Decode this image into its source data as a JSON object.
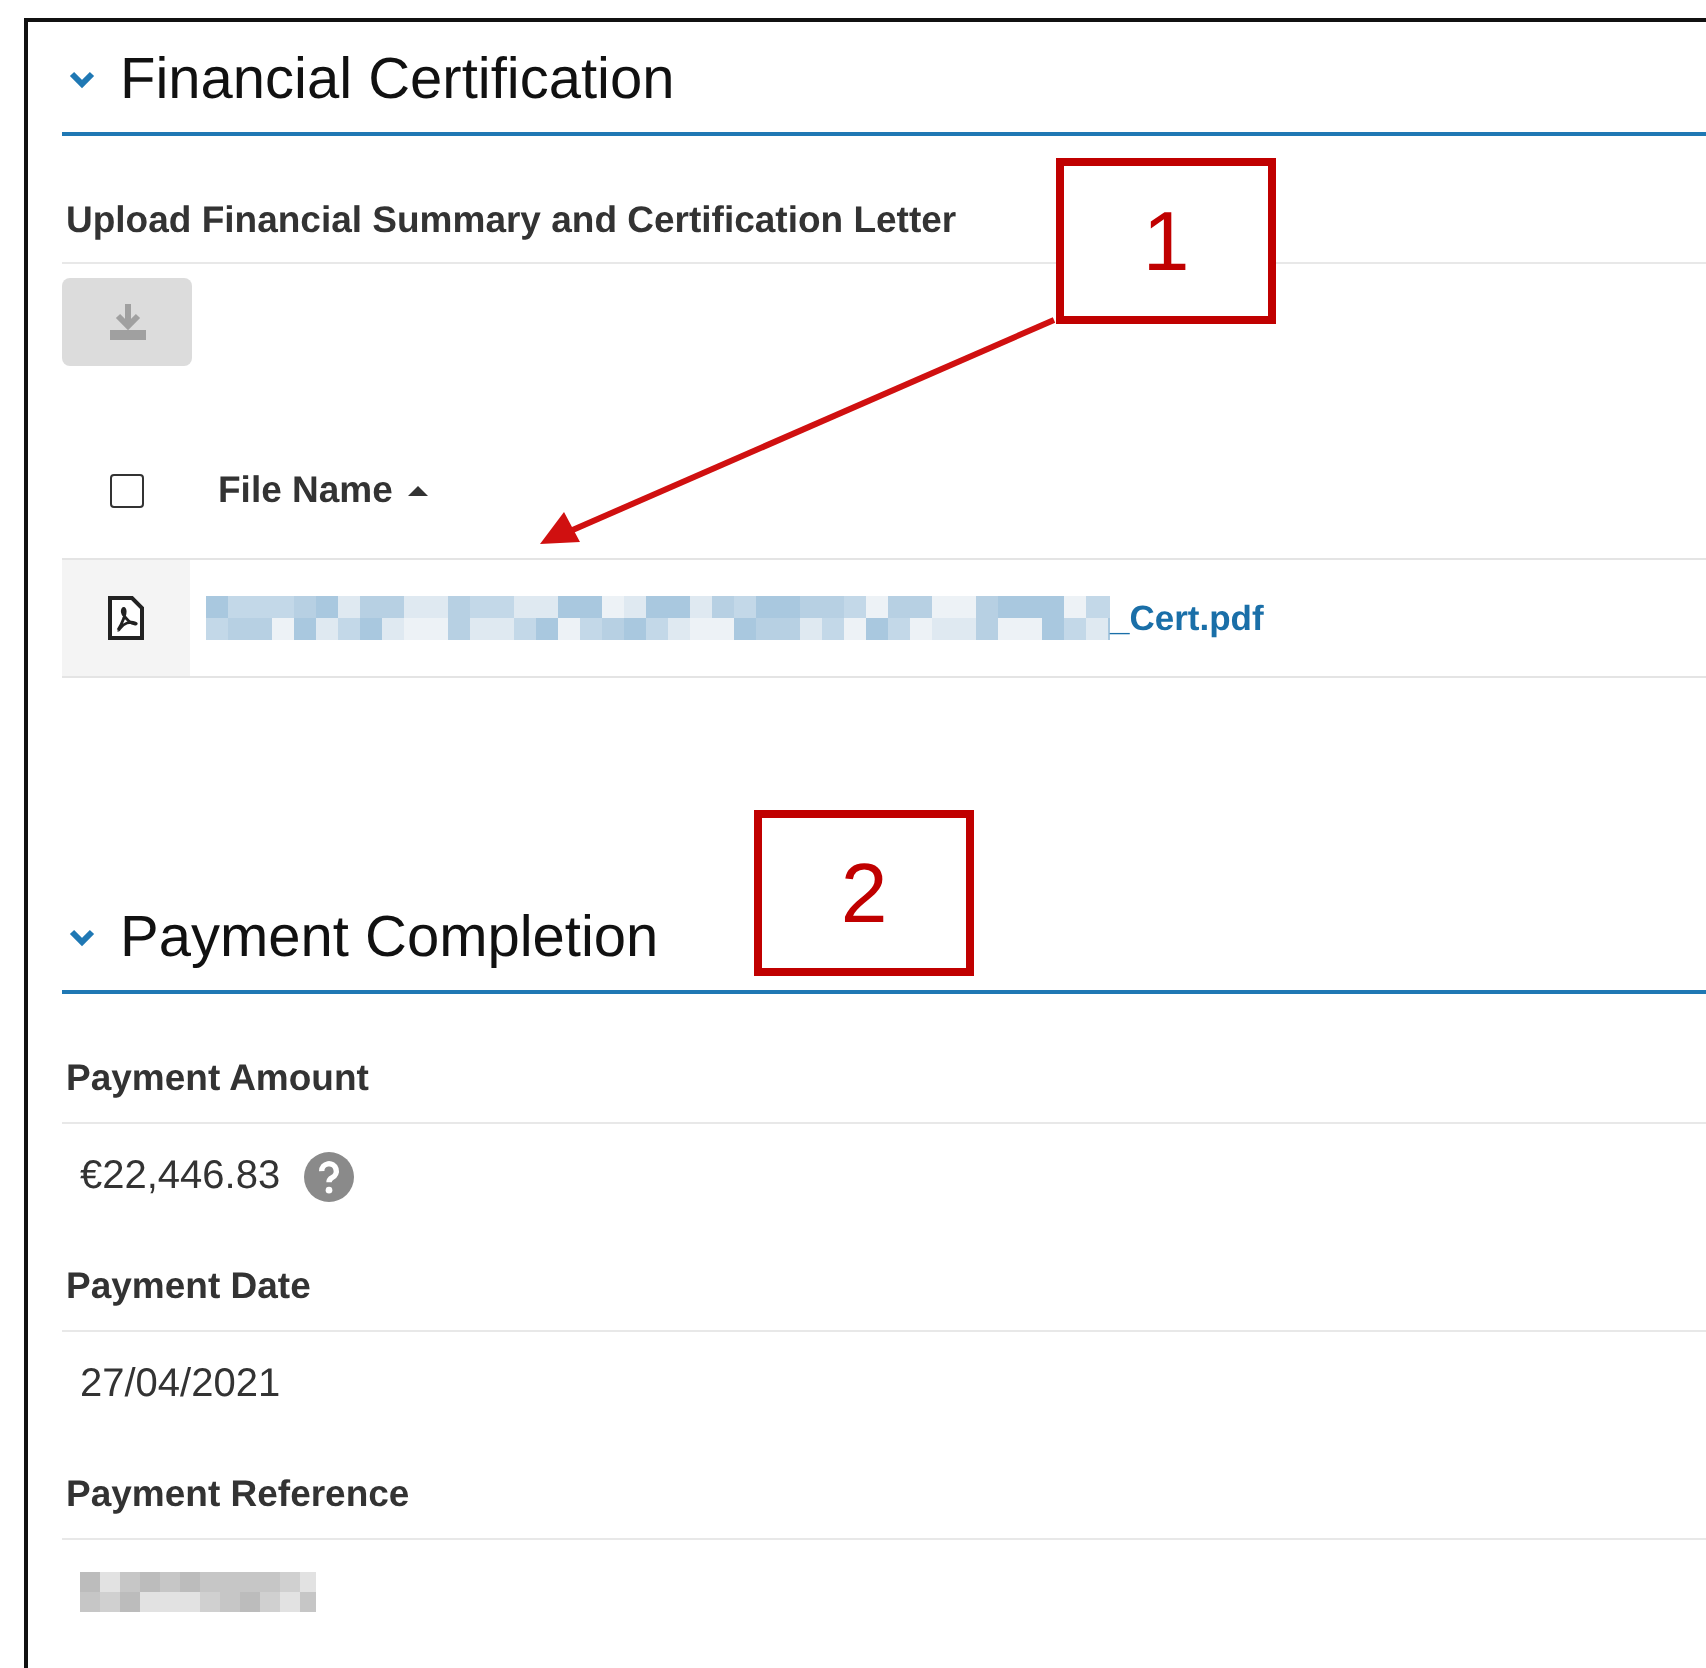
{
  "sections": [
    {
      "kind": "files",
      "title": "Financial Certification",
      "expanded": true,
      "upload": {
        "label": "Upload Financial Summary and Certification Letter",
        "button_disabled": true
      },
      "table": {
        "select_all_checked": false,
        "columns": [
          {
            "label": "File Name",
            "sorted_ascending": true
          }
        ],
        "rows": [
          {
            "file_name": "_Cert.pdf",
            "redacted_prefix": true
          }
        ]
      }
    },
    {
      "kind": "fields",
      "title": "Payment Completion",
      "expanded": true,
      "fields": [
        {
          "label": "Payment Amount",
          "value": "€22,446.83",
          "help": true
        },
        {
          "label": "Payment Date",
          "value": "27/04/2021",
          "help": false
        },
        {
          "label": "Payment Reference",
          "redacted": true
        }
      ]
    }
  ],
  "callouts": [
    {
      "label": "1",
      "arrow": true
    },
    {
      "label": "2",
      "arrow": false
    }
  ]
}
